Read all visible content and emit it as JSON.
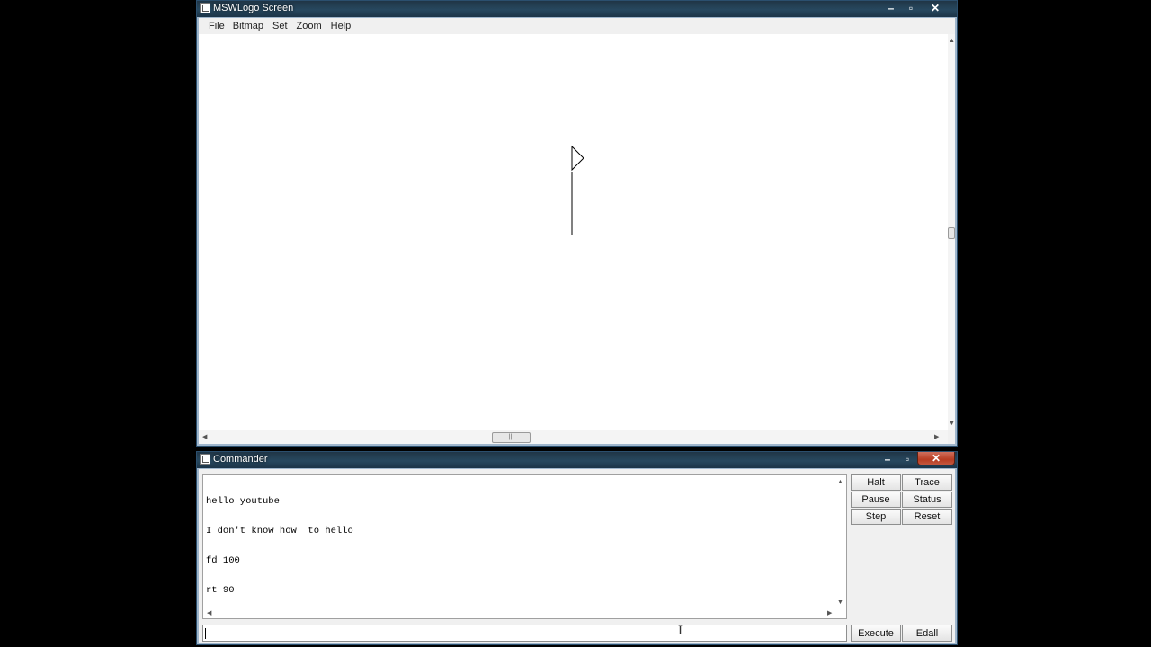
{
  "screen_window": {
    "title": "MSWLogo Screen",
    "controls": {
      "minimize": "–",
      "maximize": "▫",
      "close": "✕"
    },
    "menu": [
      "File",
      "Bitmap",
      "Set",
      "Zoom",
      "Help"
    ],
    "scrollbar_thumb_grip": "|||",
    "scroll_arrows": {
      "up": "▲",
      "down": "▼",
      "left": "◀",
      "right": "▶"
    }
  },
  "commander_window": {
    "title": "Commander",
    "controls": {
      "minimize": "–",
      "maximize": "▫",
      "close": "✕"
    },
    "output_lines": [
      "hello youtube",
      "I don't know how  to hello",
      "fd 100",
      "rt 90"
    ],
    "buttons": {
      "halt": "Halt",
      "trace": "Trace",
      "pause": "Pause",
      "status": "Status",
      "step": "Step",
      "reset": "Reset",
      "execute": "Execute",
      "edall": "Edall"
    },
    "input_value": "",
    "scroll_arrows": {
      "up": "▲",
      "down": "▼",
      "left": "◀",
      "right": "▶"
    }
  },
  "cursor_glyph": "I",
  "colors": {
    "titlebar": "#203546",
    "close_button": "#c0462b",
    "canvas": "#ffffff",
    "turtle_line": "#000000"
  },
  "icons": [
    "app-icon",
    "turtle-icon",
    "text-cursor-icon"
  ]
}
